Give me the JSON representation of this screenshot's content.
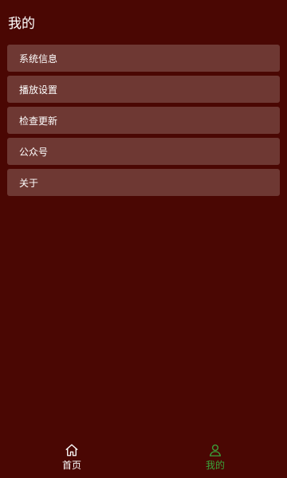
{
  "header": {
    "title": "我的"
  },
  "menu": {
    "items": [
      {
        "label": "系统信息"
      },
      {
        "label": "播放设置"
      },
      {
        "label": "检查更新"
      },
      {
        "label": "公众号"
      },
      {
        "label": "关于"
      }
    ]
  },
  "tabbar": {
    "tabs": [
      {
        "label": "首页",
        "icon": "home-icon",
        "active": false
      },
      {
        "label": "我的",
        "icon": "user-icon",
        "active": true
      }
    ]
  },
  "colors": {
    "background": "#4a0703",
    "menu_item_background": "#6e3833",
    "active_tab": "#3aa33a",
    "inactive_tab": "#ffffff"
  }
}
